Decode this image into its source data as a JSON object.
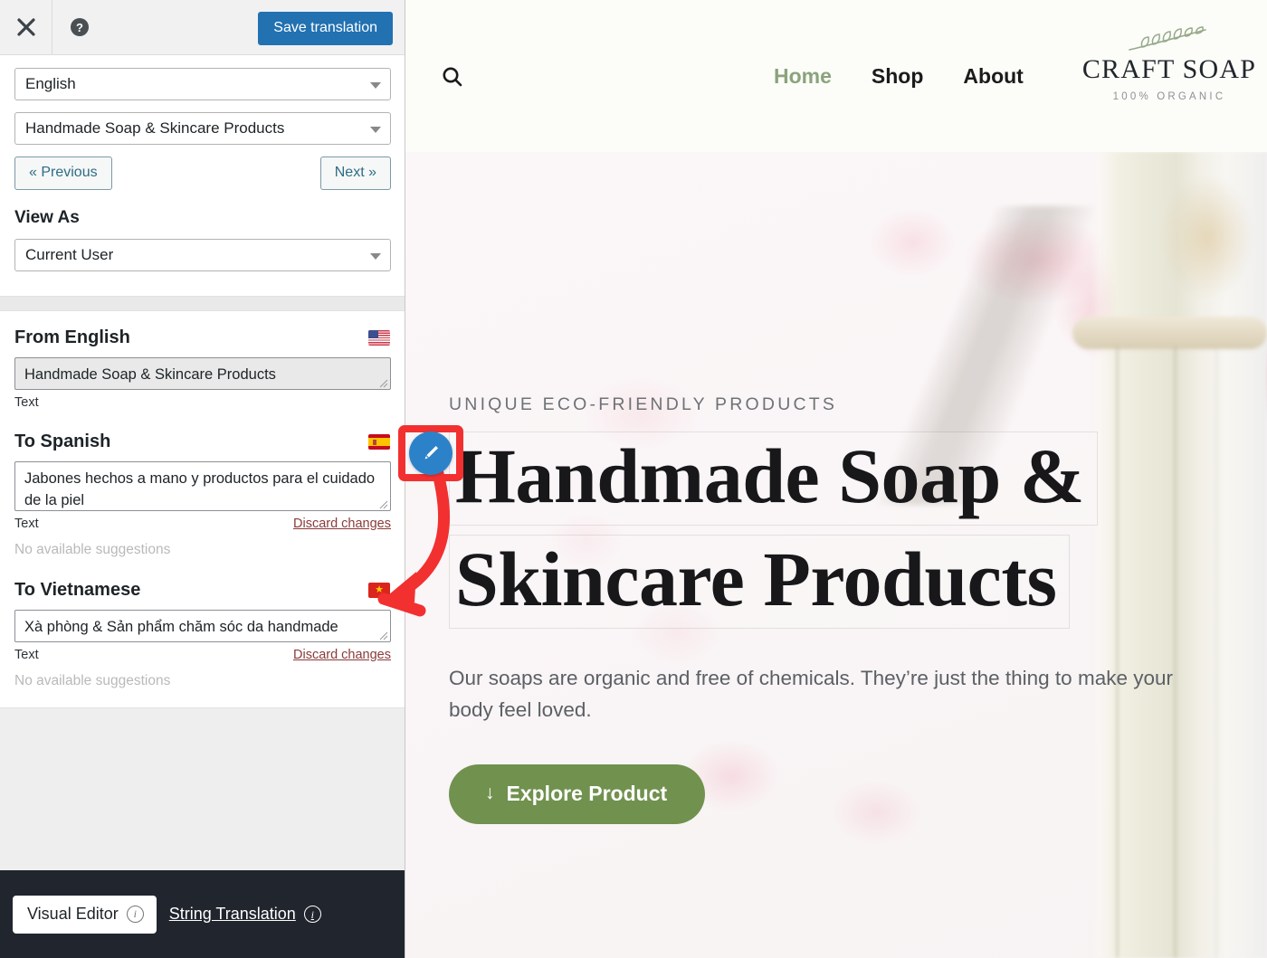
{
  "editor": {
    "topbar": {
      "close_icon": "close-icon",
      "help_icon": "help-icon",
      "save_label": "Save translation"
    },
    "language_select": "English",
    "string_select": "Handmade Soap & Skincare Products",
    "previous_label": "« Previous",
    "next_label": "Next »",
    "view_as_label": "View As",
    "view_as_value": "Current User",
    "blocks": [
      {
        "heading": "From English",
        "flag": "us-flag-icon",
        "value": "Handmade Soap & Skincare Products",
        "type_label": "Text",
        "discard_label": "",
        "suggestions": ""
      },
      {
        "heading": "To Spanish",
        "flag": "spain-flag-icon",
        "value": "Jabones hechos a mano y productos para el cuidado de la piel",
        "type_label": "Text",
        "discard_label": "Discard changes",
        "suggestions": "No available suggestions"
      },
      {
        "heading": "To Vietnamese",
        "flag": "vietnam-flag-icon",
        "value": "Xà phòng & Sản phẩm chăm sóc da handmade",
        "type_label": "Text",
        "discard_label": "Discard changes",
        "suggestions": "No available suggestions"
      }
    ],
    "footer": {
      "visual_editor_label": "Visual Editor",
      "string_translation_label": "String Translation",
      "info_glyph": "i"
    }
  },
  "site": {
    "search_icon": "search-icon",
    "nav": [
      {
        "label": "Home",
        "active": true
      },
      {
        "label": "Shop",
        "active": false
      },
      {
        "label": "About",
        "active": false
      }
    ],
    "logo": {
      "brand": "CRAFT SOAP",
      "tagline": "100% ORGANIC",
      "leaf_icon": "leaf-branch-icon"
    },
    "hero": {
      "eyebrow": "UNIQUE ECO-FRIENDLY PRODUCTS",
      "heading_line1": "Handmade Soap &",
      "heading_line2": "Skincare Products",
      "paragraph": "Our soaps are organic and free of chemicals. They’re just the thing to make your body feel loved.",
      "cta_label": "Explore Product",
      "cta_arrow": "↓"
    }
  },
  "annotation": {
    "highlight_color": "#f23030",
    "pencil_icon": "pencil-edit-icon",
    "pencil_color": "#2c82c9"
  },
  "colors": {
    "primary_button": "#2271b1",
    "cta_green": "#71914f",
    "nav_active": "#8ba37b",
    "footer_bg": "#21252e"
  }
}
